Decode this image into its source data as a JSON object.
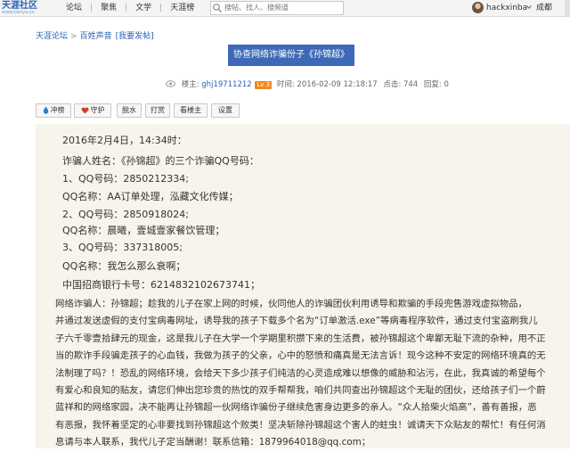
{
  "topbar": {
    "logo_text": "天涯社区",
    "logo_sub": "www.tianya.cn",
    "nav": [
      "论坛",
      "聚焦",
      "文学",
      "天涯榜"
    ],
    "search_placeholder": "搜帖、找人、搜频道",
    "username": "hackxinba",
    "city": "成都"
  },
  "breadcrumb": {
    "items": [
      "天涯论坛",
      "百姓声音"
    ],
    "post_link": "[我要发帖]"
  },
  "post": {
    "title": "协查网络诈骗份子《孙锦超》",
    "author_label": "楼主:",
    "author": "ghj19711212",
    "level": "Lv 3",
    "time_label": "时间:",
    "time": "2016-02-09 12:18:17",
    "views_label": "点击:",
    "views": "744",
    "replies_label": "回复:",
    "replies": "0"
  },
  "actions": {
    "chongbang": "冲榜",
    "shouhu": "守护",
    "tuoshui": "脱水",
    "dashang": "打赏",
    "kanlouzhu": "看楼主",
    "shezhi": "设置"
  },
  "content": {
    "lines": [
      "2016年2月4日，14:34时：",
      "诈骗人姓名：《孙锦超》的三个诈骗QQ号码：",
      "1、QQ号码：2850212334;",
      "QQ名称：AA订单处理，泓藏文化传媒；",
      "2、QQ号码：2850918024;",
      "QQ名称：晨曦，壹城壹家餐饮管理；",
      "3、QQ号码：337318005;",
      "QQ名称：我怎么那么衰啊；",
      "中国招商银行卡号：6214832102673741；"
    ],
    "paragraph": [
      "网络诈骗人：孙锦超；趁我的儿子在家上网的时候，伙同他人的诈骗团伙利用诱导和欺骗的手段兜售游戏虚拟物品，",
      "并通过发送虚假的支付宝病毒网址，诱导我的孩子下载多个名为“订单激活.exe”等病毒程序软件，通过支付宝盗刷我儿",
      "子六千零壹拾肆元的现金，这是我儿子在大学一个学期里积攒下来的生活费，被孙锦超这个卑鄙无耻下流的杂种，用不正",
      "当的欺诈手段骗走孩子的心血钱，我做为孩子的父亲，心中的怒愤和痛真是无法言诉！现今这种不安定的网络环境真的无",
      "法制理了吗？！恐乱的网络环境，会给天下多少孩子们纯洁的心灵造成难以想像的威胁和沾污，在此，我真诚的希望每个",
      "有爱心和良知的贴友，请您们伸出您珍贵的热忱的双手帮帮我，咱们共同查出孙锦超这个无耻的团伙，还给孩子们一个蔚",
      "蓝祥和的网络家园，决不能再让孙锦超一伙网络诈骗份子继续危害身边更多的亲人。“众人拾柴火焰高”，善有善报，恶",
      "有恶报，我怀着坚定的心非要找到孙锦超这个败类！坚决斩除孙锦超这个害人的蛀虫！诚请天下众贴友的帮忙！有任何消",
      "息请与本人联系，我代儿子定当酬谢！联系信箱：1879964018@qq.com；"
    ]
  }
}
